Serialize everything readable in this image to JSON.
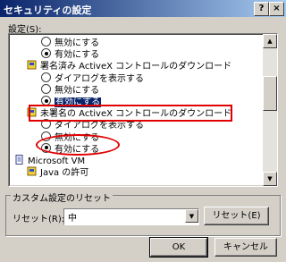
{
  "window": {
    "title": "セキュリティの設定",
    "help_label": "?",
    "close_label": "×"
  },
  "settings_label": "設定(S):",
  "list": [
    {
      "kind": "radio",
      "label": "無効にする",
      "checked": false,
      "indent": 2
    },
    {
      "kind": "radio",
      "label": "有効にする",
      "checked": true,
      "indent": 2
    },
    {
      "kind": "category",
      "label": "署名済み ActiveX コントロールのダウンロード",
      "indent": 1
    },
    {
      "kind": "radio",
      "label": "ダイアログを表示する",
      "checked": false,
      "indent": 2
    },
    {
      "kind": "radio",
      "label": "無効にする",
      "checked": false,
      "indent": 2
    },
    {
      "kind": "radio",
      "label": "有効にする",
      "checked": true,
      "indent": 2,
      "selected": true
    },
    {
      "kind": "category",
      "label": "未署名の ActiveX コントロールのダウンロード",
      "indent": 1
    },
    {
      "kind": "radio",
      "label": "ダイアログを表示する",
      "checked": false,
      "indent": 2
    },
    {
      "kind": "radio",
      "label": "無効にする",
      "checked": false,
      "indent": 2
    },
    {
      "kind": "radio",
      "label": "有効にする",
      "checked": true,
      "indent": 2
    },
    {
      "kind": "root",
      "label": "Microsoft VM",
      "indent": 0
    },
    {
      "kind": "category",
      "label": "Java の許可",
      "indent": 1
    }
  ],
  "reset_group": {
    "title": "カスタム設定のリセット",
    "reset_label": "リセット(R):",
    "combo_value": "中",
    "reset_button": "リセット(E)"
  },
  "buttons": {
    "ok": "OK",
    "cancel": "キャンセル"
  },
  "colors": {
    "highlight": "#e00000",
    "selection": "#0a246a"
  }
}
